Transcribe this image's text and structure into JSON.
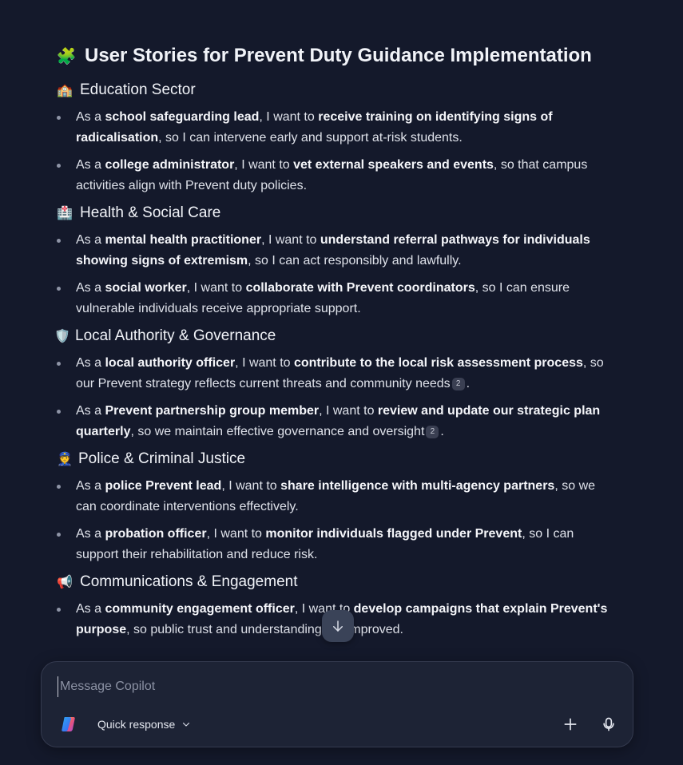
{
  "title": {
    "icon": "puzzle-icon",
    "text": "User Stories for Prevent Duty Guidance Implementation"
  },
  "sections": [
    {
      "icon": "school-icon",
      "heading": "Education Sector",
      "items": [
        {
          "p1": "As a ",
          "b1": "school safeguarding lead",
          "p2": ", I want to ",
          "b2": "receive training on identifying signs of radicalisation",
          "p3": ", so I can intervene early and support at-risk students."
        },
        {
          "p1": "As a ",
          "b1": "college administrator",
          "p2": ", I want to ",
          "b2": "vet external speakers and events",
          "p3": ", so that campus activities align with Prevent duty policies."
        }
      ]
    },
    {
      "icon": "hospital-icon",
      "heading": "Health & Social Care",
      "items": [
        {
          "p1": "As a ",
          "b1": "mental health practitioner",
          "p2": ", I want to ",
          "b2": "understand referral pathways for individuals showing signs of extremism",
          "p3": ", so I can act responsibly and lawfully."
        },
        {
          "p1": "As a ",
          "b1": "social worker",
          "p2": ", I want to ",
          "b2": "collaborate with Prevent coordinators",
          "p3": ", so I can ensure vulnerable individuals receive appropriate support."
        }
      ]
    },
    {
      "icon": "shield-icon",
      "heading": "Local Authority & Governance",
      "items": [
        {
          "p1": "As a ",
          "b1": "local authority officer",
          "p2": ", I want to ",
          "b2": "contribute to the local risk assessment process",
          "p3": ", so our Prevent strategy reflects current threats and community needs",
          "cite": "2",
          "p4": "."
        },
        {
          "p1": "As a ",
          "b1": "Prevent partnership group member",
          "p2": ", I want to ",
          "b2": "review and update our strategic plan quarterly",
          "p3": ", so we maintain effective governance and oversight",
          "cite": "2",
          "p4": "."
        }
      ]
    },
    {
      "icon": "police-officer-icon",
      "heading": "Police & Criminal Justice",
      "items": [
        {
          "p1": "As a ",
          "b1": "police Prevent lead",
          "p2": ", I want to ",
          "b2": "share intelligence with multi-agency partners",
          "p3": ", so we can coordinate interventions effectively."
        },
        {
          "p1": "As a ",
          "b1": "probation officer",
          "p2": ", I want to ",
          "b2": "monitor individuals flagged under Prevent",
          "p3": ", so I can support their rehabilitation and reduce risk."
        }
      ]
    },
    {
      "icon": "megaphone-icon",
      "heading": "Communications & Engagement",
      "items": [
        {
          "p1": "As a ",
          "b1": "community engagement officer",
          "p2": ", I want to ",
          "b2": "develop campaigns that explain Prevent's purpose",
          "p3": ", so public trust and understanding are improved."
        }
      ]
    }
  ],
  "composer": {
    "placeholder": "Message Copilot",
    "mode_label": "Quick response",
    "logo_icon": "copilot-logo-icon",
    "mode_icon": "chevron-down-icon",
    "add_icon": "plus-icon",
    "mic_icon": "microphone-icon"
  },
  "scroll_button_icon": "arrow-down-icon",
  "colors": {
    "background": "#14192b",
    "composer": "#1d2335",
    "text": "#e3e6ee"
  }
}
